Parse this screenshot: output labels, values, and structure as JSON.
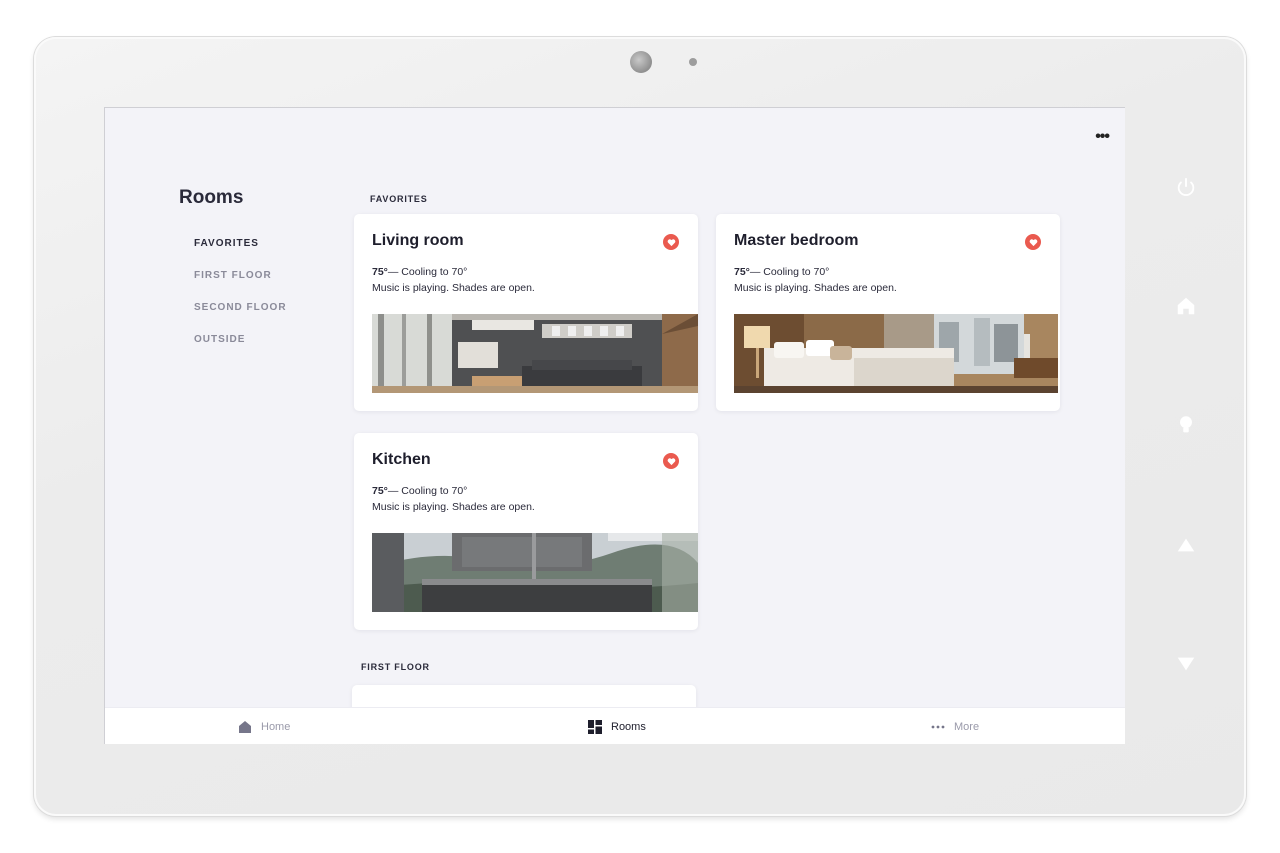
{
  "screen": {
    "more_menu": "•••",
    "sidebar": {
      "title": "Rooms",
      "items": [
        {
          "label": "FAVORITES",
          "active": true
        },
        {
          "label": "FIRST FLOOR",
          "active": false
        },
        {
          "label": "SECOND FLOOR",
          "active": false
        },
        {
          "label": "OUTSIDE",
          "active": false
        }
      ]
    },
    "sections": [
      {
        "label": "FAVORITES",
        "cards": [
          {
            "title": "Living room",
            "temp": "75°",
            "temp_detail": "— Cooling to 70°",
            "status": "Music is playing. Shades are open.",
            "favorite": true
          },
          {
            "title": "Master bedroom",
            "temp": "75°",
            "temp_detail": "— Cooling to 70°",
            "status": "Music is playing. Shades are open.",
            "favorite": true
          },
          {
            "title": "Kitchen",
            "temp": "75°",
            "temp_detail": "— Cooling to 70°",
            "status": "Music is playing. Shades are open.",
            "favorite": true
          }
        ]
      },
      {
        "label": "FIRST FLOOR",
        "cards": []
      }
    ],
    "tabbar": [
      {
        "label": "Home",
        "icon": "home-icon",
        "active": false
      },
      {
        "label": "Rooms",
        "icon": "rooms-grid-icon",
        "active": true
      },
      {
        "label": "More",
        "icon": "more-dots-icon",
        "active": false
      }
    ]
  },
  "device_buttons": [
    "power-icon",
    "home-icon",
    "lightbulb-icon",
    "arrow-up-icon",
    "arrow-down-icon"
  ],
  "colors": {
    "accent_favorite": "#ea5a4f",
    "screen_bg": "#f3f3f8",
    "text_dark": "#1e1e2c",
    "text_muted": "#8a8a99"
  }
}
